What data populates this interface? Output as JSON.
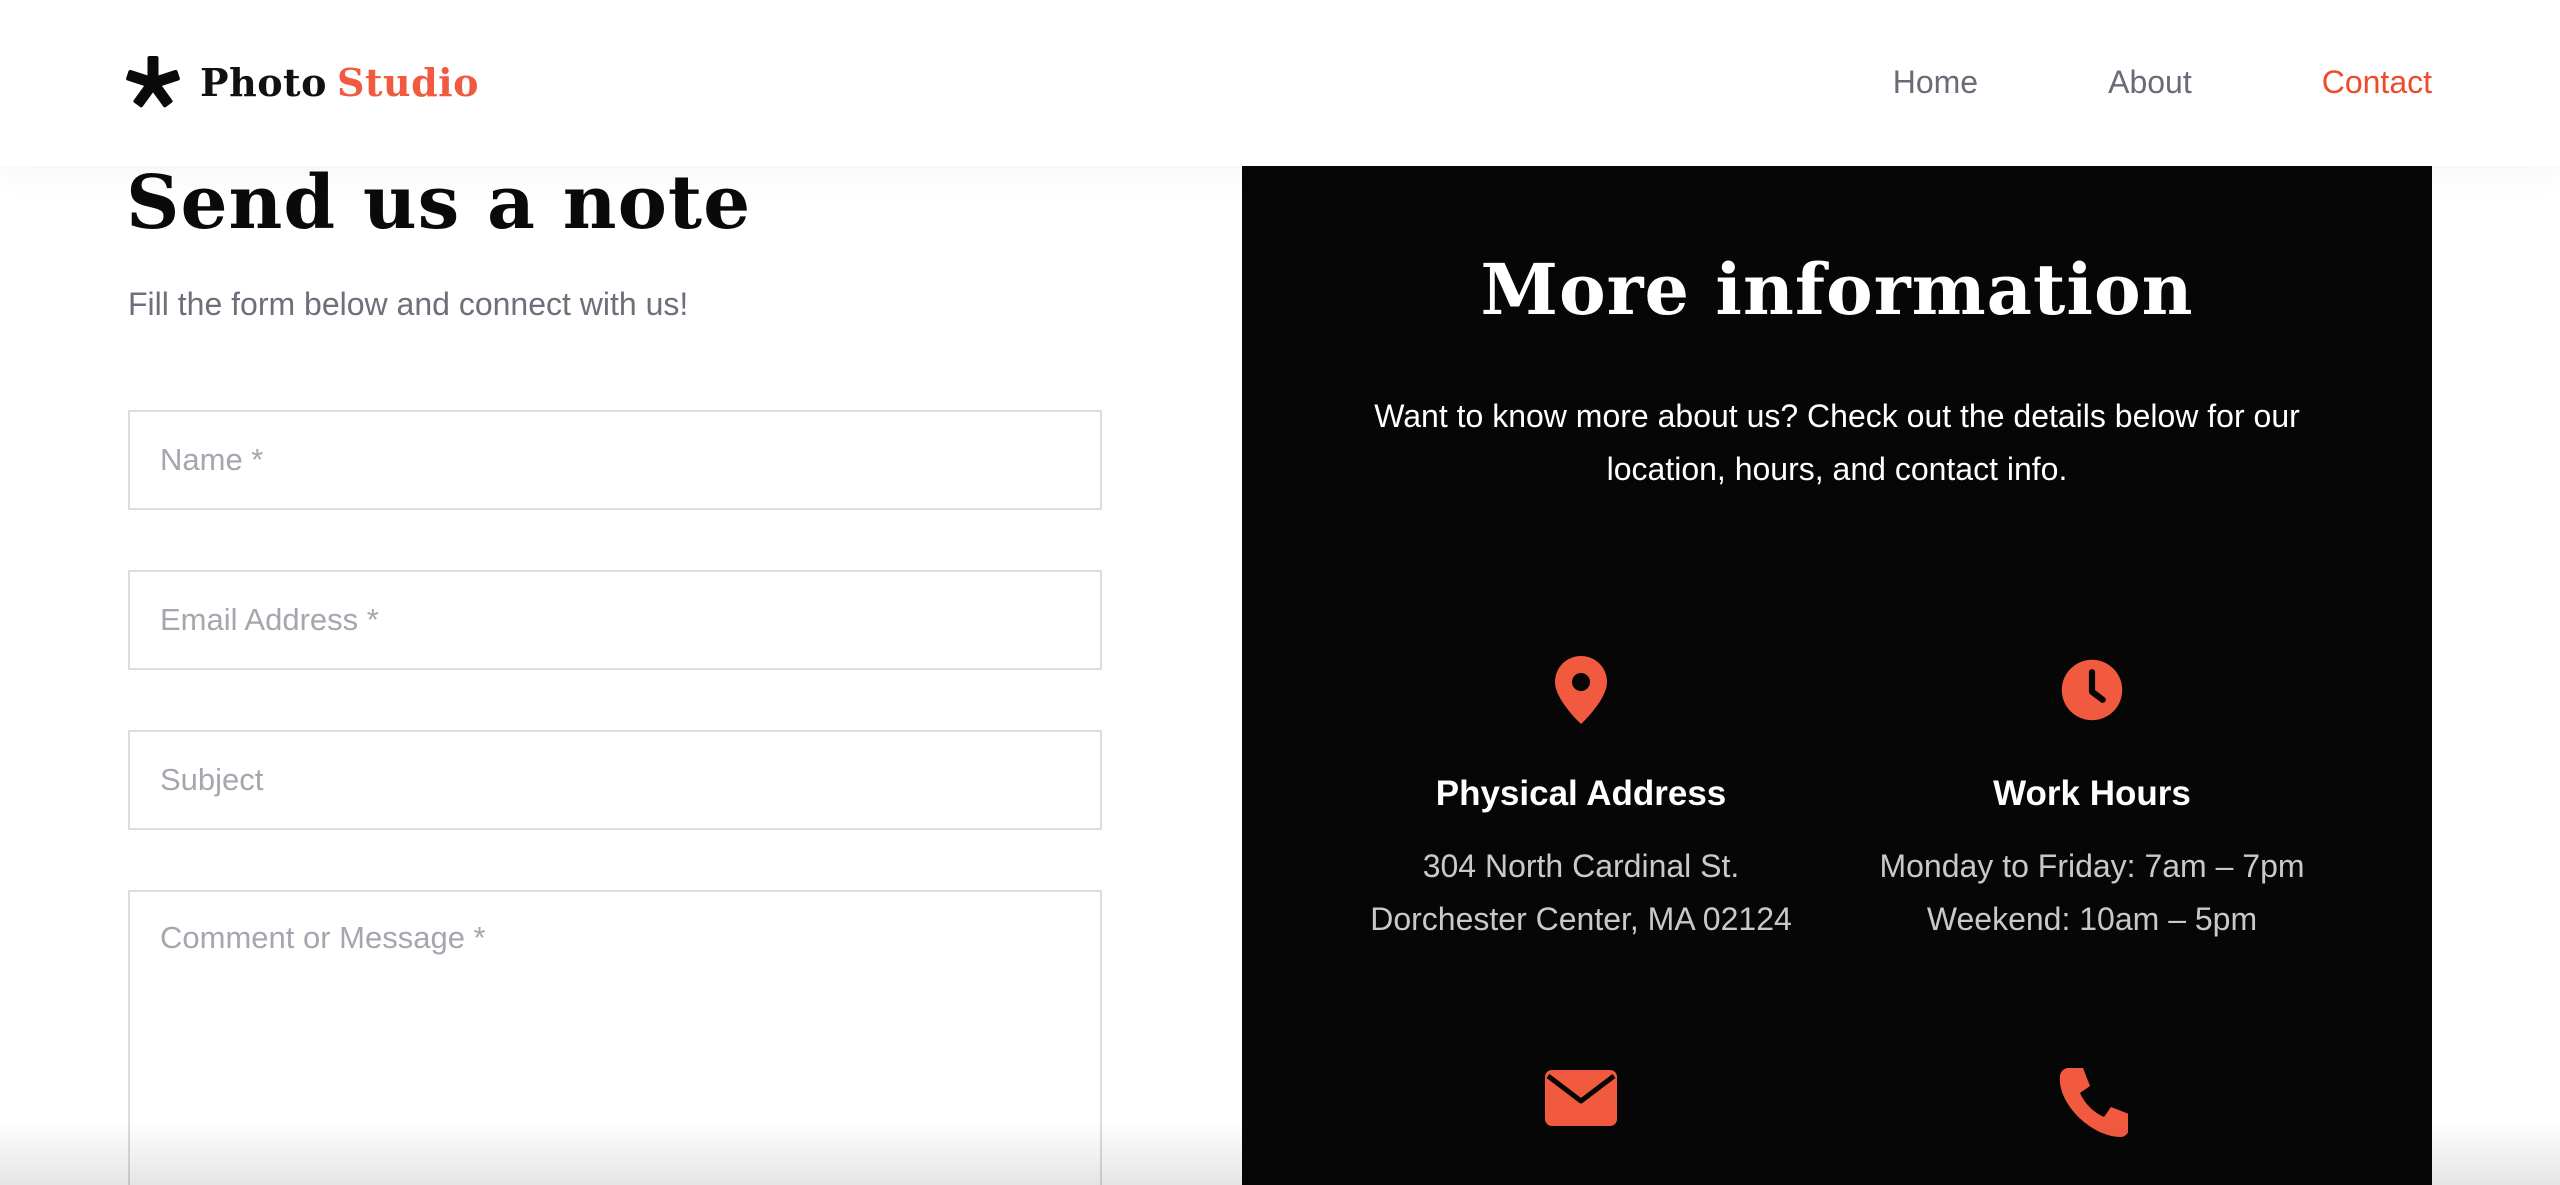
{
  "colors": {
    "accent": "#f25a3f",
    "nav_active": "#f04a2c",
    "panel_bg": "#060606"
  },
  "brand": {
    "name_part1": "Photo",
    "name_part2": "Studio",
    "icon": "asterisk-icon"
  },
  "nav": {
    "home": "Home",
    "about": "About",
    "contact": "Contact",
    "active": "Contact"
  },
  "form": {
    "title": "Send us a note",
    "subtitle": "Fill the form below and connect with us!",
    "name_placeholder": "Name *",
    "email_placeholder": "Email Address *",
    "subject_placeholder": "Subject",
    "message_placeholder": "Comment or Message *"
  },
  "info": {
    "title": "More information",
    "description": "Want to know more about us? Check out the details below for our location, hours, and contact info.",
    "address": {
      "icon": "map-pin-icon",
      "title": "Physical Address",
      "line1": "304 North Cardinal St.",
      "line2": "Dorchester Center, MA 02124"
    },
    "hours": {
      "icon": "clock-icon",
      "title": "Work Hours",
      "line1": "Monday to Friday: 7am – 7pm",
      "line2": "Weekend: 10am – 5pm"
    },
    "email": {
      "icon": "envelope-icon"
    },
    "phone": {
      "icon": "phone-icon"
    }
  }
}
